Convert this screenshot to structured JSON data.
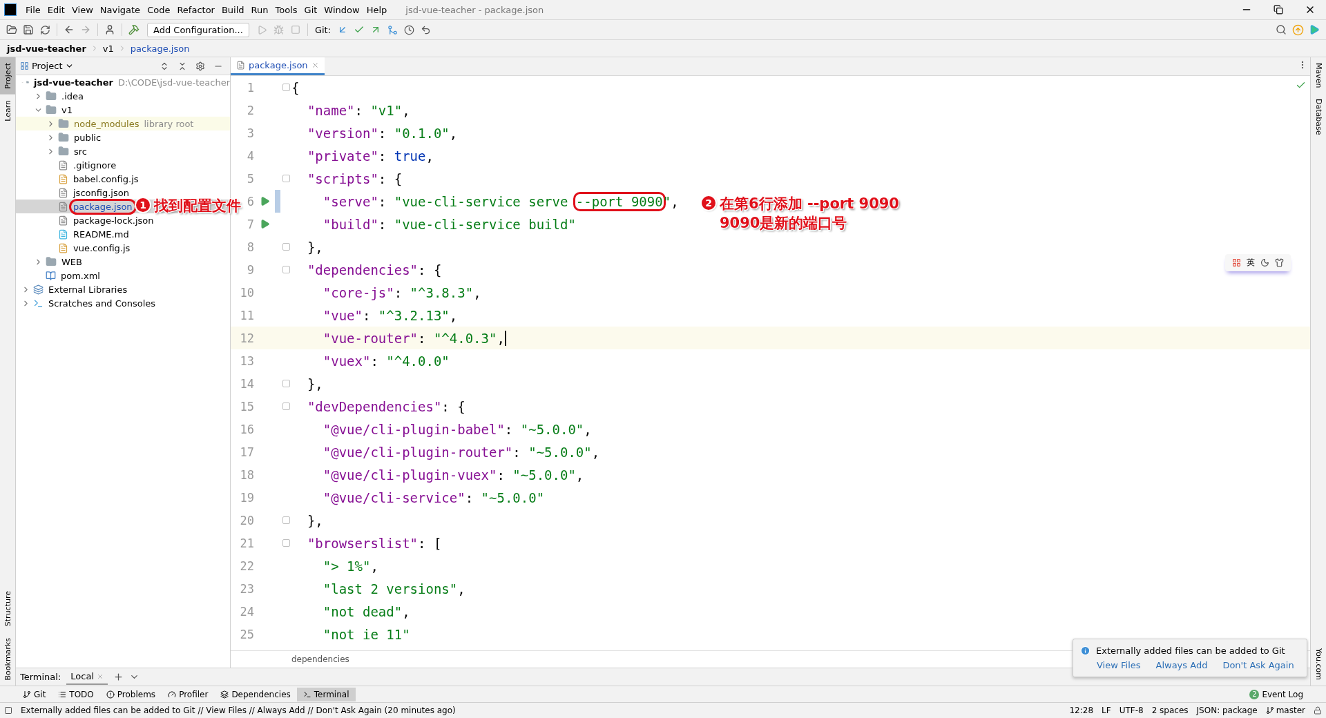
{
  "window": {
    "title": "jsd-vue-teacher - package.json"
  },
  "menu": [
    "File",
    "Edit",
    "View",
    "Navigate",
    "Code",
    "Refactor",
    "Build",
    "Run",
    "Tools",
    "Git",
    "Window",
    "Help"
  ],
  "toolbar": {
    "run_config": "Add Configuration...",
    "git_label": "Git:"
  },
  "breadcrumb": [
    "jsd-vue-teacher",
    "v1",
    "package.json"
  ],
  "left_strip": [
    {
      "label": "Project",
      "selected": true
    },
    {
      "label": "Learn",
      "selected": false
    },
    {
      "label": "Structure",
      "selected": false
    },
    {
      "label": "Bookmarks",
      "selected": false
    }
  ],
  "right_strip": [
    "Maven",
    "Database",
    "You.com"
  ],
  "project_panel": {
    "title": "Project",
    "tree": [
      {
        "name": "jsd-vue-teacher",
        "hint": "D:\\CODE\\jsd-vue-teacher",
        "kind": "project",
        "expanded": true,
        "selected": false,
        "circled": false,
        "children": [
          {
            "name": ".idea",
            "kind": "folder",
            "expanded": false,
            "selected": false,
            "circled": false
          },
          {
            "name": "v1",
            "kind": "folder",
            "expanded": true,
            "selected": false,
            "circled": false,
            "children": [
              {
                "name": "node_modules",
                "hint": "library root",
                "kind": "library",
                "expanded": false,
                "selected": false,
                "circled": false
              },
              {
                "name": "public",
                "kind": "folder",
                "expanded": false,
                "selected": false,
                "circled": false
              },
              {
                "name": "src",
                "kind": "folder",
                "expanded": false,
                "selected": false,
                "circled": false
              },
              {
                "name": ".gitignore",
                "kind": "ignore",
                "selected": false,
                "circled": false
              },
              {
                "name": "babel.config.js",
                "kind": "js",
                "selected": false,
                "circled": false
              },
              {
                "name": "jsconfig.json",
                "kind": "json",
                "selected": false,
                "circled": false
              },
              {
                "name": "package.json",
                "kind": "json",
                "selected": true,
                "circled": true
              },
              {
                "name": "package-lock.json",
                "kind": "json",
                "selected": false,
                "circled": false
              },
              {
                "name": "README.md",
                "kind": "md",
                "selected": false,
                "circled": false
              },
              {
                "name": "vue.config.js",
                "kind": "js",
                "selected": false,
                "circled": false
              }
            ]
          },
          {
            "name": "WEB",
            "kind": "folder",
            "expanded": false,
            "selected": false,
            "circled": false
          },
          {
            "name": "pom.xml",
            "kind": "maven",
            "selected": false,
            "circled": false
          }
        ]
      },
      {
        "name": "External Libraries",
        "kind": "libraries",
        "expanded": false,
        "selected": false,
        "circled": false
      },
      {
        "name": "Scratches and Consoles",
        "kind": "scratches",
        "expanded": false,
        "selected": false,
        "circled": false
      }
    ]
  },
  "editor": {
    "tabs": [
      {
        "label": "package.json",
        "selected": true
      }
    ],
    "lines": [
      {
        "n": "1",
        "fold": true,
        "tokens": [
          {
            "kind": "punct",
            "text": "{"
          }
        ]
      },
      {
        "n": "2",
        "tokens": [
          {
            "kind": "key",
            "text": "  \"name\""
          },
          {
            "kind": "punct",
            "text": ": "
          },
          {
            "kind": "string",
            "text": "\"v1\""
          },
          {
            "kind": "punct",
            "text": ","
          }
        ]
      },
      {
        "n": "3",
        "tokens": [
          {
            "kind": "key",
            "text": "  \"version\""
          },
          {
            "kind": "punct",
            "text": ": "
          },
          {
            "kind": "string",
            "text": "\"0.1.0\""
          },
          {
            "kind": "punct",
            "text": ","
          }
        ]
      },
      {
        "n": "4",
        "tokens": [
          {
            "kind": "key",
            "text": "  \"private\""
          },
          {
            "kind": "punct",
            "text": ": "
          },
          {
            "kind": "keyword",
            "text": "true"
          },
          {
            "kind": "punct",
            "text": ","
          }
        ]
      },
      {
        "n": "5",
        "fold": true,
        "tokens": [
          {
            "kind": "key",
            "text": "  \"scripts\""
          },
          {
            "kind": "punct",
            "text": ": {"
          }
        ]
      },
      {
        "n": "6",
        "run": true,
        "changed": true,
        "tokens": [
          {
            "kind": "key",
            "text": "    \"serve\""
          },
          {
            "kind": "punct",
            "text": ": "
          },
          {
            "kind": "string",
            "text": "\"vue-cli-service serve "
          },
          {
            "kind": "string",
            "text": "--port 9090",
            "boxed": true
          },
          {
            "kind": "string",
            "text": "\""
          },
          {
            "kind": "punct",
            "text": ","
          }
        ]
      },
      {
        "n": "7",
        "run": true,
        "tokens": [
          {
            "kind": "key",
            "text": "    \"build\""
          },
          {
            "kind": "punct",
            "text": ": "
          },
          {
            "kind": "string",
            "text": "\"vue-cli-service build\""
          }
        ]
      },
      {
        "n": "8",
        "fold": true,
        "tokens": [
          {
            "kind": "punct",
            "text": "  },"
          }
        ]
      },
      {
        "n": "9",
        "fold": true,
        "tokens": [
          {
            "kind": "key",
            "text": "  \"dependencies\""
          },
          {
            "kind": "punct",
            "text": ": {"
          }
        ]
      },
      {
        "n": "10",
        "tokens": [
          {
            "kind": "key",
            "text": "    \"core-js\""
          },
          {
            "kind": "punct",
            "text": ": "
          },
          {
            "kind": "string",
            "text": "\"^3.8.3\""
          },
          {
            "kind": "punct",
            "text": ","
          }
        ]
      },
      {
        "n": "11",
        "tokens": [
          {
            "kind": "key",
            "text": "    \"vue\""
          },
          {
            "kind": "punct",
            "text": ": "
          },
          {
            "kind": "string",
            "text": "\"^3.2.13\""
          },
          {
            "kind": "punct",
            "text": ","
          }
        ]
      },
      {
        "n": "12",
        "current": true,
        "tokens": [
          {
            "kind": "key",
            "text": "    \"vue-router\""
          },
          {
            "kind": "punct",
            "text": ": "
          },
          {
            "kind": "string",
            "text": "\"^4.0.3\""
          },
          {
            "kind": "punct",
            "text": ","
          }
        ]
      },
      {
        "n": "13",
        "tokens": [
          {
            "kind": "key",
            "text": "    \"vuex\""
          },
          {
            "kind": "punct",
            "text": ": "
          },
          {
            "kind": "string",
            "text": "\"^4.0.0\""
          }
        ]
      },
      {
        "n": "14",
        "fold": true,
        "tokens": [
          {
            "kind": "punct",
            "text": "  },"
          }
        ]
      },
      {
        "n": "15",
        "fold": true,
        "tokens": [
          {
            "kind": "key",
            "text": "  \"devDependencies\""
          },
          {
            "kind": "punct",
            "text": ": {"
          }
        ]
      },
      {
        "n": "16",
        "tokens": [
          {
            "kind": "key",
            "text": "    \"@vue/cli-plugin-babel\""
          },
          {
            "kind": "punct",
            "text": ": "
          },
          {
            "kind": "string",
            "text": "\"~5.0.0\""
          },
          {
            "kind": "punct",
            "text": ","
          }
        ]
      },
      {
        "n": "17",
        "tokens": [
          {
            "kind": "key",
            "text": "    \"@vue/cli-plugin-router\""
          },
          {
            "kind": "punct",
            "text": ": "
          },
          {
            "kind": "string",
            "text": "\"~5.0.0\""
          },
          {
            "kind": "punct",
            "text": ","
          }
        ]
      },
      {
        "n": "18",
        "tokens": [
          {
            "kind": "key",
            "text": "    \"@vue/cli-plugin-vuex\""
          },
          {
            "kind": "punct",
            "text": ": "
          },
          {
            "kind": "string",
            "text": "\"~5.0.0\""
          },
          {
            "kind": "punct",
            "text": ","
          }
        ]
      },
      {
        "n": "19",
        "tokens": [
          {
            "kind": "key",
            "text": "    \"@vue/cli-service\""
          },
          {
            "kind": "punct",
            "text": ": "
          },
          {
            "kind": "string",
            "text": "\"~5.0.0\""
          }
        ]
      },
      {
        "n": "20",
        "fold": true,
        "tokens": [
          {
            "kind": "punct",
            "text": "  },"
          }
        ]
      },
      {
        "n": "21",
        "fold": true,
        "tokens": [
          {
            "kind": "key",
            "text": "  \"browserslist\""
          },
          {
            "kind": "punct",
            "text": ": ["
          }
        ]
      },
      {
        "n": "22",
        "tokens": [
          {
            "kind": "string",
            "text": "    \"> 1%\""
          },
          {
            "kind": "punct",
            "text": ","
          }
        ]
      },
      {
        "n": "23",
        "tokens": [
          {
            "kind": "string",
            "text": "    \"last 2 versions\""
          },
          {
            "kind": "punct",
            "text": ","
          }
        ]
      },
      {
        "n": "24",
        "tokens": [
          {
            "kind": "string",
            "text": "    \"not dead\""
          },
          {
            "kind": "punct",
            "text": ","
          }
        ]
      },
      {
        "n": "25",
        "tokens": [
          {
            "kind": "string",
            "text": "    \"not ie 11\""
          }
        ]
      }
    ],
    "breadcrumb": "dependencies"
  },
  "annotations": [
    {
      "number": "1",
      "lines": [
        "找到配置文件"
      ]
    },
    {
      "number": "2",
      "lines": [
        "在第6行添加 --port 9090",
        "9090是新的端口号"
      ]
    }
  ],
  "ime_toolbar": {
    "label": "英"
  },
  "notification": {
    "message": "Externally added files can be added to Git",
    "actions": [
      "View Files",
      "Always Add",
      "Don't Ask Again"
    ]
  },
  "terminal_bar": {
    "label": "Terminal:",
    "tabs": [
      "Local"
    ]
  },
  "tool_windows": [
    {
      "label": "Git",
      "kind": "git",
      "selected": false
    },
    {
      "label": "TODO",
      "kind": "todo",
      "selected": false
    },
    {
      "label": "Problems",
      "kind": "problems",
      "selected": false
    },
    {
      "label": "Profiler",
      "kind": "profiler",
      "selected": false
    },
    {
      "label": "Dependencies",
      "kind": "dependencies",
      "selected": false
    },
    {
      "label": "Terminal",
      "kind": "terminal",
      "selected": true
    }
  ],
  "event_log": {
    "label": "Event Log",
    "count": "2"
  },
  "status_bar": {
    "message": "Externally added files can be added to Git // View Files // Always Add // Don't Ask Again (20 minutes ago)",
    "items": [
      "12:28",
      "LF",
      "UTF-8",
      "2 spaces",
      "JSON: package"
    ],
    "branch": "master"
  }
}
